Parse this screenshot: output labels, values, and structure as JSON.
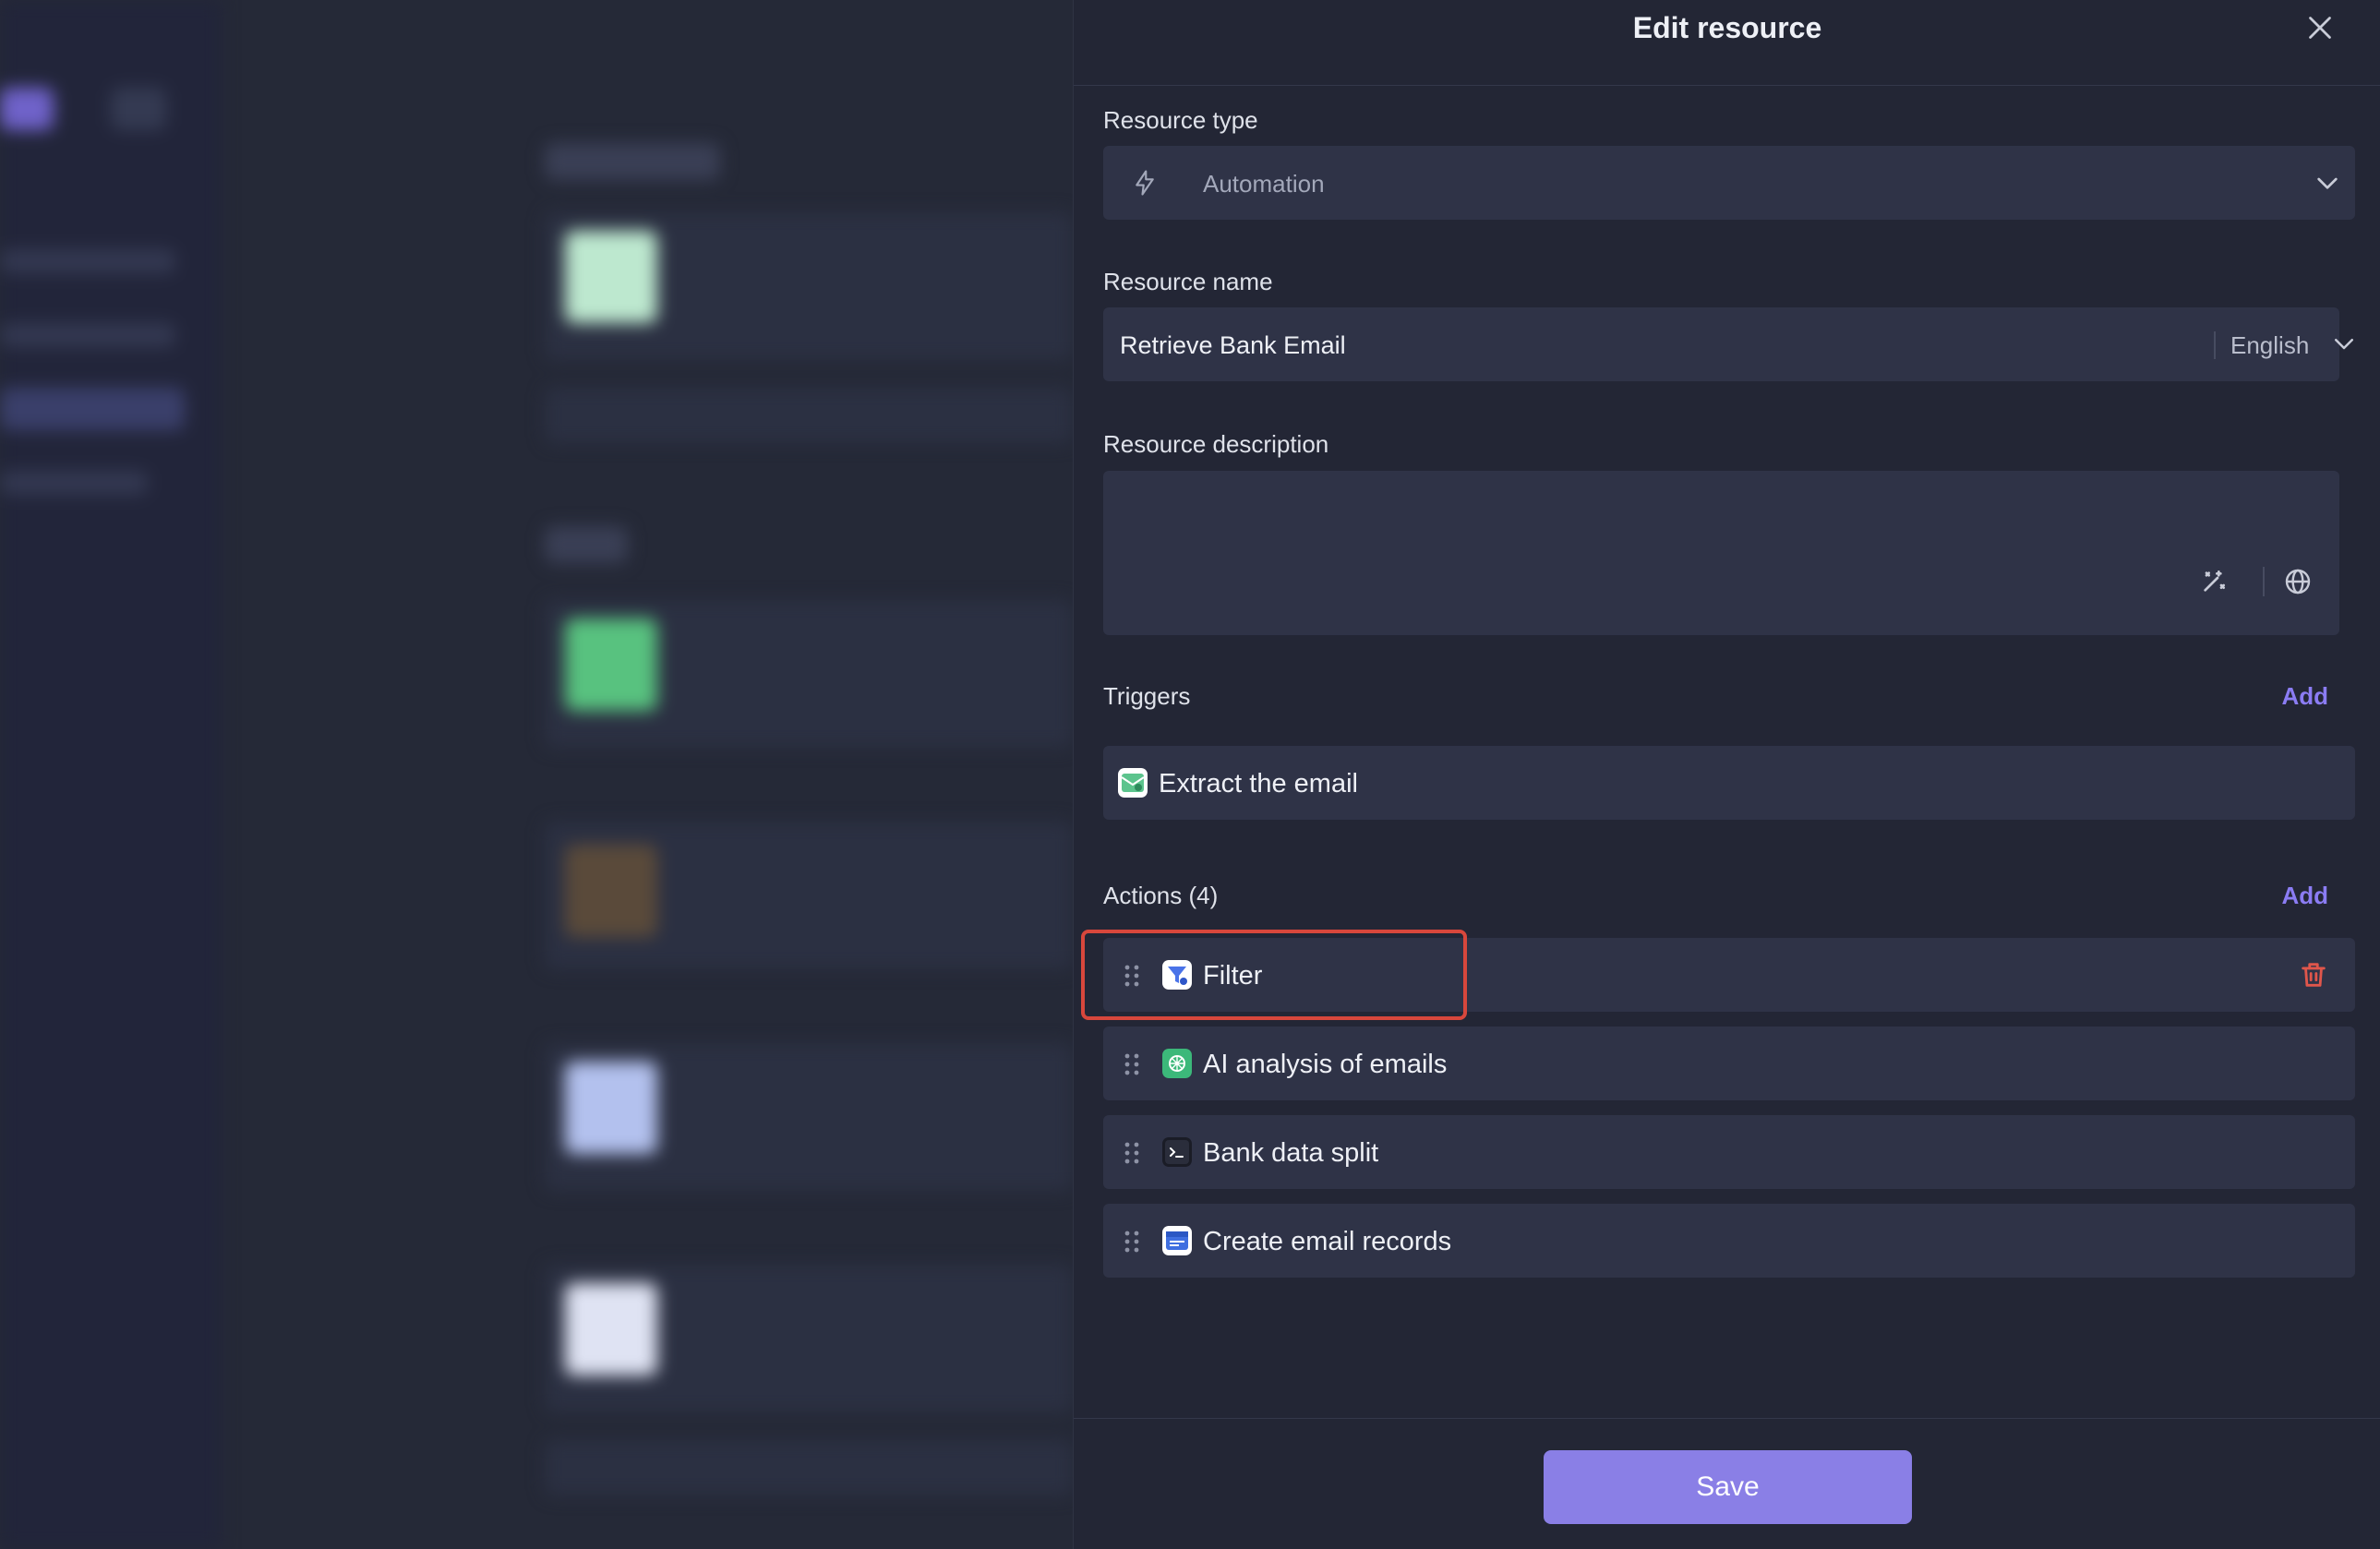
{
  "panel": {
    "title": "Edit resource",
    "resource_type": {
      "label": "Resource type",
      "value": "Automation",
      "icon": "bolt-icon"
    },
    "resource_name": {
      "label": "Resource name",
      "value": "Retrieve Bank Email",
      "language": "English"
    },
    "resource_description": {
      "label": "Resource description",
      "value": ""
    },
    "triggers": {
      "label": "Triggers",
      "add_label": "Add",
      "items": [
        {
          "label": "Extract the email",
          "icon": "mail-extract-icon"
        }
      ]
    },
    "actions": {
      "label": "Actions (4)",
      "add_label": "Add",
      "items": [
        {
          "label": "Filter",
          "icon": "filter-icon"
        },
        {
          "label": "AI analysis of emails",
          "icon": "ai-icon"
        },
        {
          "label": "Bank data split",
          "icon": "terminal-icon"
        },
        {
          "label": "Create email records",
          "icon": "record-icon"
        }
      ]
    },
    "save_label": "Save"
  },
  "colors": {
    "accent": "#8a7fe6",
    "link": "#8b7cf3",
    "danger": "#d8473c",
    "panel_bg": "#232635",
    "field_bg": "#2f3347"
  }
}
